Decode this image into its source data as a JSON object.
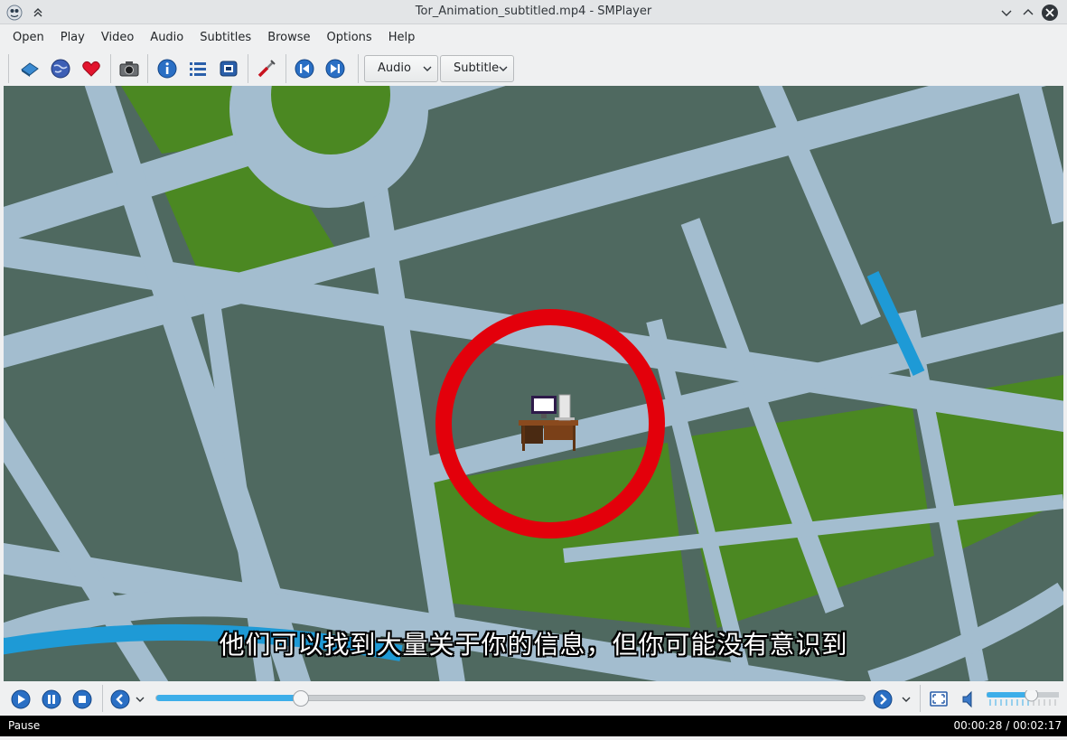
{
  "window": {
    "title": "Tor_Animation_subtitled.mp4 - SMPlayer"
  },
  "menu": {
    "items": [
      "Open",
      "Play",
      "Video",
      "Audio",
      "Subtitles",
      "Browse",
      "Options",
      "Help"
    ]
  },
  "toolbar": {
    "icons": [
      "open-file-icon",
      "open-url-icon",
      "favorites-icon",
      "screenshot-icon",
      "info-icon",
      "playlist-icon",
      "equalizer-icon",
      "preferences-icon",
      "previous-icon",
      "next-icon"
    ],
    "audio_combo": "Audio",
    "subtitle_combo": "Subtitle"
  },
  "video": {
    "subtitle_text": "他们可以找到大量关于你的信息，但你可能没有意识到"
  },
  "controls": {
    "seek_progress": 0.204,
    "volume_level": 0.62
  },
  "status": {
    "state": "Pause",
    "time": "00:00:28 / 00:02:17"
  },
  "colors": {
    "accent": "#3daee9",
    "map_block": "#4f6960",
    "map_road": "#a3bdcf",
    "park": "#4b8822",
    "water": "#1e9ad6",
    "marker": "#e3000b"
  }
}
